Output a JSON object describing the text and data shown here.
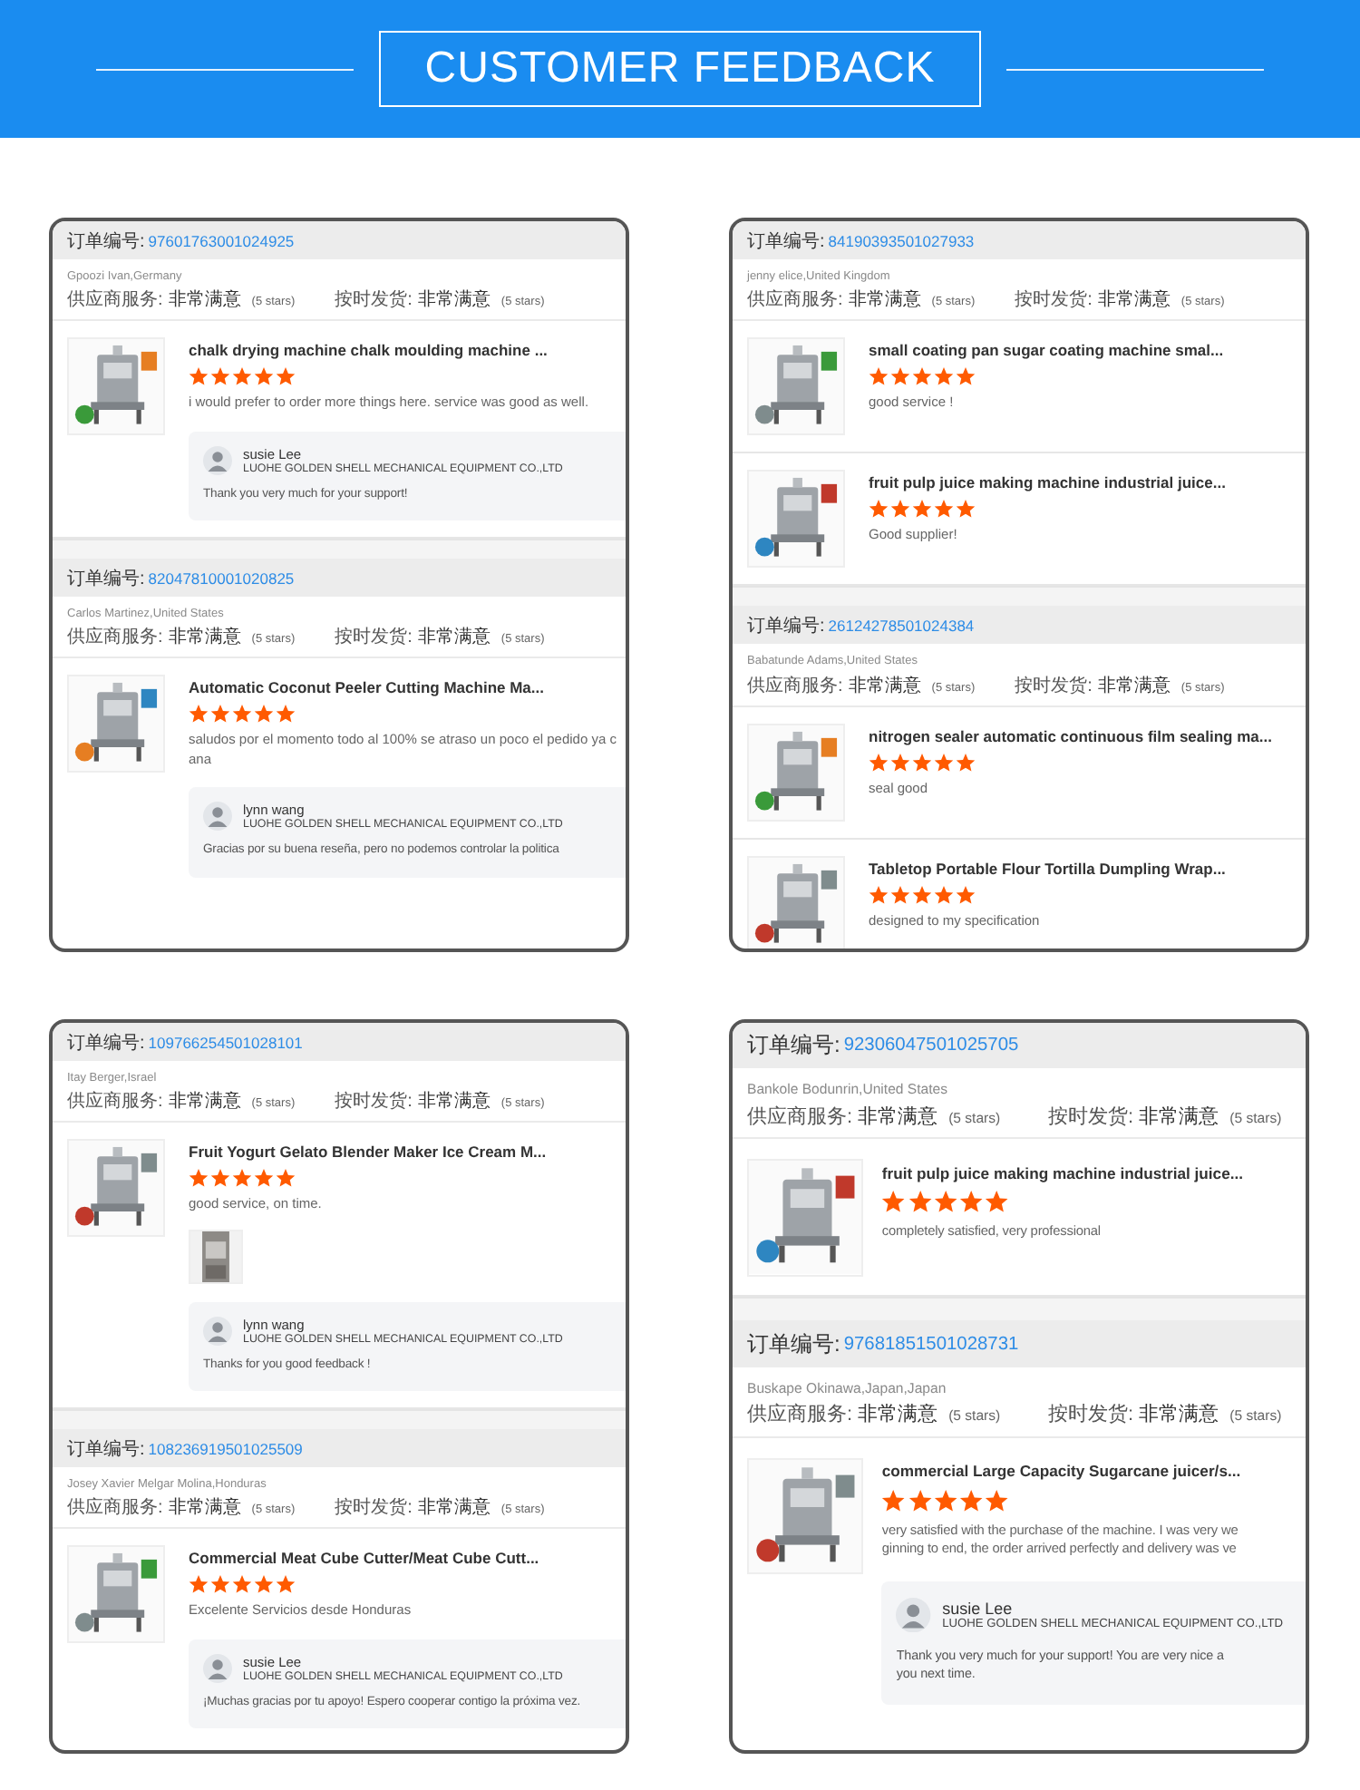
{
  "header": {
    "title": "CUSTOMER FEEDBACK"
  },
  "cards": [
    {
      "orders": [
        {
          "order_label": "订单编号:",
          "order_no": "97601763001024925",
          "buyer": "Gpoozi Ivan,Germany",
          "ratings": [
            {
              "label": "供应商服务:",
              "value": "非常满意",
              "note": "(5 stars)"
            },
            {
              "label": "按时发货:",
              "value": "非常满意",
              "note": "(5 stars)"
            }
          ],
          "items": [
            {
              "title": "chalk drying machine chalk moulding machine ...",
              "stars": 5,
              "comment": [
                "i would prefer to order more things here. service was good as well."
              ],
              "image": {
                "kind": "picture"
              },
              "reply": {
                "name": "susie Lee",
                "company": "LUOHE GOLDEN SHELL MECHANICAL EQUIPMENT CO.,LTD",
                "message": [
                  "Thank you very much for your support!"
                ]
              }
            }
          ]
        },
        {
          "order_label": "订单编号:",
          "order_no": "82047810001020825",
          "buyer": "Carlos Martinez,United States",
          "ratings": [
            {
              "label": "供应商服务:",
              "value": "非常满意",
              "note": "(5 stars)"
            },
            {
              "label": "按时发货:",
              "value": "非常满意",
              "note": "(5 stars)"
            }
          ],
          "items": [
            {
              "title": "Automatic Coconut Peeler Cutting Machine Ma...",
              "stars": 5,
              "comment": [
                "saludos por el momento todo al 100% se atraso un poco el pedido ya c",
                "ana"
              ],
              "image": {
                "kind": "picture"
              },
              "reply": {
                "name": "lynn wang",
                "company": "LUOHE GOLDEN SHELL MECHANICAL EQUIPMENT CO.,LTD",
                "message": [
                  "Gracias por su buena reseña, pero no podemos controlar la politica"
                ]
              }
            }
          ]
        }
      ]
    },
    {
      "orders": [
        {
          "order_label": "订单编号:",
          "order_no": "84190393501027933",
          "buyer": "jenny elice,United Kingdom",
          "ratings": [
            {
              "label": "供应商服务:",
              "value": "非常满意",
              "note": "(5 stars)"
            },
            {
              "label": "按时发货:",
              "value": "非常满意",
              "note": "(5 stars)"
            }
          ],
          "items": [
            {
              "title": "small coating pan sugar coating machine smal...",
              "stars": 5,
              "comment": [
                "good service !"
              ],
              "image": {
                "kind": "picture"
              }
            },
            {
              "title": "fruit pulp juice making machine industrial juice...",
              "stars": 5,
              "comment": [
                "Good supplier!"
              ],
              "image": {
                "kind": "picture"
              }
            }
          ]
        },
        {
          "order_label": "订单编号:",
          "order_no": "26124278501024384",
          "buyer": "Babatunde Adams,United States",
          "ratings": [
            {
              "label": "供应商服务:",
              "value": "非常满意",
              "note": "(5 stars)"
            },
            {
              "label": "按时发货:",
              "value": "非常满意",
              "note": "(5 stars)"
            }
          ],
          "items": [
            {
              "title": "nitrogen sealer automatic continuous film sealing ma...",
              "stars": 5,
              "comment": [
                "seal good"
              ],
              "image": {
                "kind": "picture"
              }
            },
            {
              "title": "Tabletop Portable Flour Tortilla Dumpling Wrap...",
              "stars": 5,
              "comment": [
                "designed to my specification"
              ],
              "image": {
                "kind": "picture"
              }
            }
          ]
        }
      ]
    },
    {
      "orders": [
        {
          "order_label": "订单编号:",
          "order_no": "109766254501028101",
          "buyer": "Itay Berger,Israel",
          "ratings": [
            {
              "label": "供应商服务:",
              "value": "非常满意",
              "note": "(5 stars)"
            },
            {
              "label": "按时发货:",
              "value": "非常满意",
              "note": "(5 stars)"
            }
          ],
          "items": [
            {
              "title": "Fruit Yogurt Gelato Blender Maker Ice Cream M...",
              "stars": 5,
              "comment": [
                "good service, on time."
              ],
              "image": {
                "kind": "picture"
              },
              "photos": [
                {
                  "kind": "picture"
                }
              ],
              "reply": {
                "name": "lynn wang",
                "company": "LUOHE GOLDEN SHELL MECHANICAL EQUIPMENT CO.,LTD",
                "message": [
                  "Thanks for you good feedback !"
                ]
              }
            }
          ]
        },
        {
          "order_label": "订单编号:",
          "order_no": "108236919501025509",
          "buyer": "Josey Xavier Melgar Molina,Honduras",
          "ratings": [
            {
              "label": "供应商服务:",
              "value": "非常满意",
              "note": "(5 stars)"
            },
            {
              "label": "按时发货:",
              "value": "非常满意",
              "note": "(5 stars)"
            }
          ],
          "items": [
            {
              "title": "Commercial Meat Cube Cutter/Meat Cube Cutt...",
              "stars": 5,
              "comment": [
                "Excelente Servicios desde Honduras"
              ],
              "image": {
                "kind": "picture"
              },
              "reply": {
                "name": "susie Lee",
                "company": "LUOHE GOLDEN SHELL MECHANICAL EQUIPMENT CO.,LTD",
                "message": [
                  "¡Muchas gracias por tu apoyo! Espero cooperar contigo la próxima vez."
                ]
              }
            }
          ]
        }
      ]
    },
    {
      "orders": [
        {
          "order_label": "订单编号:",
          "order_no": "92306047501025705",
          "buyer": "Bankole Bodunrin,United States",
          "ratings": [
            {
              "label": "供应商服务:",
              "value": "非常满意",
              "note": "(5 stars)"
            },
            {
              "label": "按时发货:",
              "value": "非常满意",
              "note": "(5 stars)"
            }
          ],
          "items": [
            {
              "title": "fruit pulp juice making machine industrial juice...",
              "stars": 5,
              "comment": [
                "completely satisfied, very professional"
              ],
              "image": {
                "kind": "picture"
              }
            }
          ]
        },
        {
          "order_label": "订单编号:",
          "order_no": "97681851501028731",
          "buyer": "Buskape Okinawa,Japan,Japan",
          "ratings": [
            {
              "label": "供应商服务:",
              "value": "非常满意",
              "note": "(5 stars)"
            },
            {
              "label": "按时发货:",
              "value": "非常满意",
              "note": "(5 stars)"
            }
          ],
          "items": [
            {
              "title": "commercial Large Capacity Sugarcane juicer/s...",
              "stars": 5,
              "comment": [
                "very satisfied with the purchase of the machine. I was very we",
                "ginning to end, the order arrived perfectly and delivery was ve"
              ],
              "image": {
                "kind": "picture"
              },
              "reply": {
                "name": "susie Lee",
                "company": "LUOHE GOLDEN SHELL MECHANICAL EQUIPMENT CO.,LTD",
                "message": [
                  "Thank you very much for your support! You are very nice a",
                  "you next time."
                ]
              }
            }
          ]
        }
      ]
    }
  ]
}
